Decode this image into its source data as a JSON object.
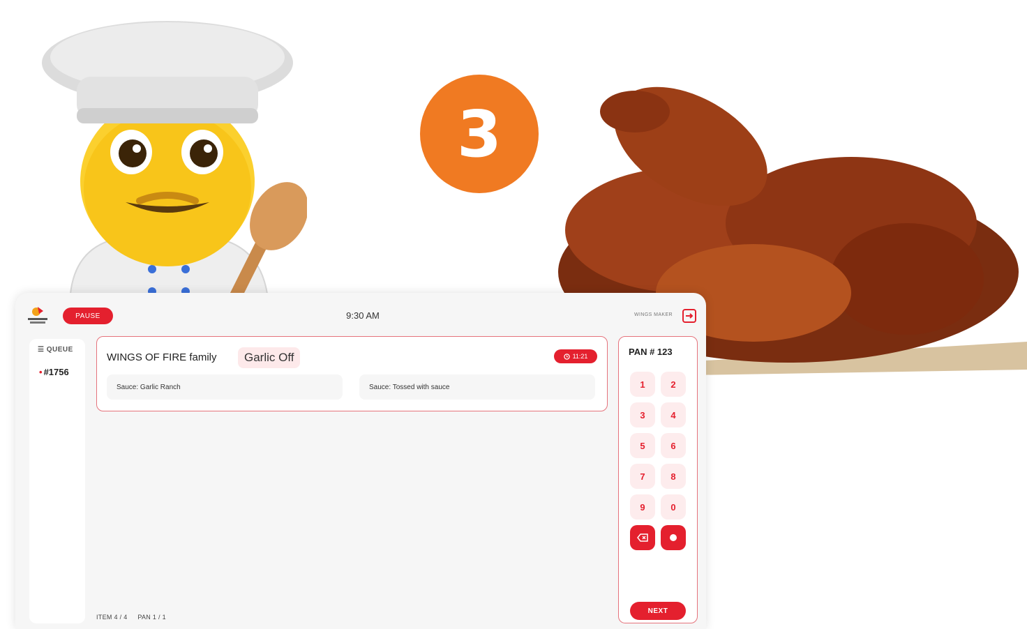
{
  "hero": {
    "step_number": "3",
    "colors": {
      "step_circle": "#f07a22",
      "accent": "#e4202e"
    }
  },
  "header": {
    "pause_label": "PAUSE",
    "time": "9:30 AM",
    "station_label": "WINGS MAKER",
    "exit_icon": "logout-icon"
  },
  "sidebar": {
    "queue_label": "QUEUE",
    "orders": [
      "#1756"
    ]
  },
  "order": {
    "item_name": "WINGS OF FIRE family",
    "modifier": "Garlic Off",
    "timer": "11:21",
    "details": [
      "Sauce: Garlic Ranch",
      "Sauce: Tossed with sauce"
    ]
  },
  "footer": {
    "item_progress": "ITEM 4 / 4",
    "pan_progress": "PAN 1 / 1"
  },
  "pan": {
    "title": "PAN # 123",
    "keys": [
      "1",
      "2",
      "3",
      "4",
      "5",
      "6",
      "7",
      "8",
      "9",
      "0"
    ],
    "backspace_icon": "backspace-icon",
    "confirm_icon": "dot-icon",
    "next_label": "NEXT"
  }
}
